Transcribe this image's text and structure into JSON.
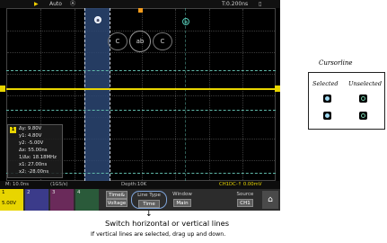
{
  "topbar": {
    "run_status": "Auto",
    "timebase": "T:0.200ns"
  },
  "cursors": {
    "a_label": "a",
    "b_label": "b",
    "knob_left": "C",
    "knob_center": "ab",
    "knob_right": "C"
  },
  "measurements": {
    "channel": "1",
    "delta_y": "Δy: 9.80V",
    "y1": "y1: 4.80V",
    "y2": "y2: -5.00V",
    "delta_x": "Δx: 55.00ns",
    "freq": "1/Δx: 18.18MHz",
    "x1": "x1: 27.00ns",
    "x2": "x2: -28.00ns"
  },
  "statusbar": {
    "horizontal": "M: 10.0ns",
    "sample_rate": "(1GS/s)",
    "depth": "Depth:10K",
    "trigger": "CH1DC-↑ 0.00mV"
  },
  "softkeys": {
    "ch1_label": "1",
    "ch1_value": "5.00V",
    "ch2_label": "2",
    "ch3_label": "3",
    "ch4_label": "4",
    "time_voltage_top": "Time&",
    "time_voltage_bottom": "Voltage",
    "line_type_label": "Line Type",
    "line_type_value": "Time",
    "window_label": "Window",
    "window_value": "Main",
    "source_label": "Source",
    "source_value": "CH1"
  },
  "caption": {
    "arrow": "↓",
    "title": "Switch horizontal or vertical lines",
    "subtitle": "If vertical lines are selected, drag up and down."
  },
  "legend": {
    "title": "Cursorline",
    "selected_label": "Selected",
    "unselected_label": "Unselected"
  },
  "colors": {
    "ch1": "#e8d500",
    "cursor_line": "#5fb7a8",
    "selected_band": "#2c4773"
  }
}
